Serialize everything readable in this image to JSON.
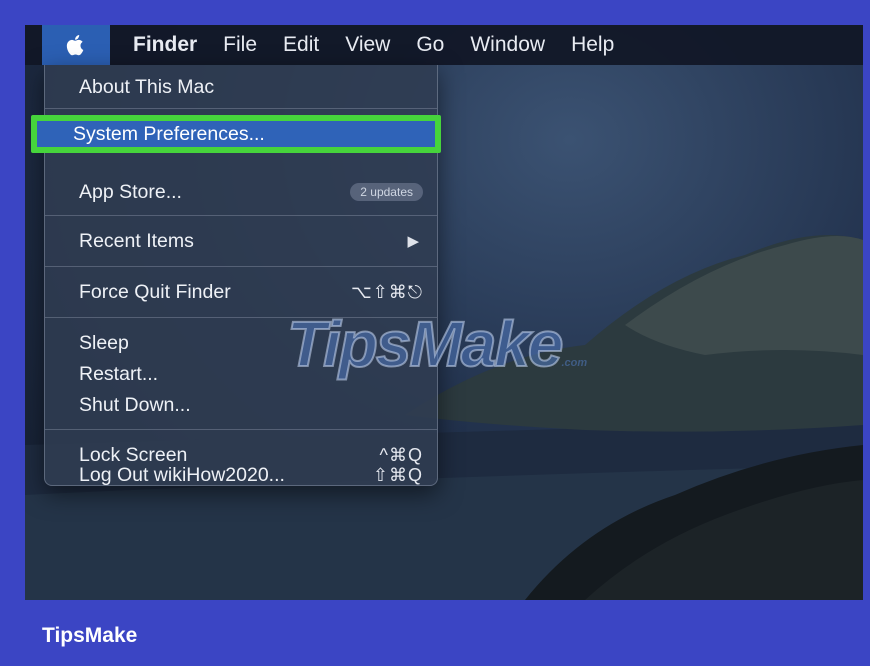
{
  "menubar": {
    "items": [
      "Finder",
      "File",
      "Edit",
      "View",
      "Go",
      "Window",
      "Help"
    ]
  },
  "apple_menu": {
    "about": "About This Mac",
    "system_prefs": "System Preferences...",
    "app_store": "App Store...",
    "app_store_badge": "2 updates",
    "recent_items": "Recent Items",
    "force_quit": "Force Quit Finder",
    "force_quit_shortcut": "⌥⇧⌘⎋",
    "sleep": "Sleep",
    "restart": "Restart...",
    "shut_down": "Shut Down...",
    "lock_screen": "Lock Screen",
    "lock_screen_shortcut": "^⌘Q",
    "log_out": "Log Out wikiHow2020...",
    "log_out_shortcut": "⇧⌘Q"
  },
  "watermark": {
    "text": "TipsMake",
    "suffix": ".com"
  },
  "footer": {
    "brand": "TipsMake"
  },
  "colors": {
    "frame": "#3b45c4",
    "highlight_border": "#46d43c",
    "selection": "#2f63b8"
  }
}
